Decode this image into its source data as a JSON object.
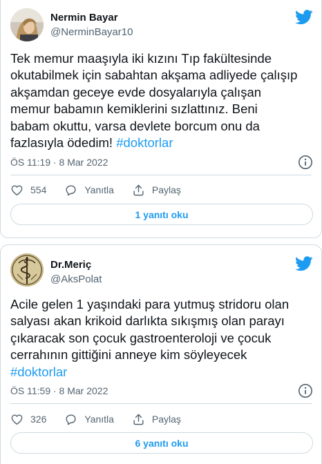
{
  "tweets": [
    {
      "author_name": "Nermin Bayar",
      "author_handle": "@NerminBayar10",
      "text": "Tek memur maaşıyla iki kızını Tıp fakültesinde\nokutabilmek için sabahtan akşama adliyede çalışıp\nakşamdan geceye evde dosyalarıyla çalışan\nmemur babamın kemiklerini sızlattınız. Beni\nbabam okuttu, varsa devlete borcum onu da\nfazlasıyla ödedim! ",
      "hashtag": "#doktorlar",
      "timestamp": "ÖS 11:19 · 8 Mar 2022",
      "like_count": "554",
      "reply_label": "Yanıtla",
      "share_label": "Paylaş",
      "replies_button": "1 yanıtı oku"
    },
    {
      "author_name": "Dr.Meriç",
      "author_handle": "@AksPolat",
      "text": "Acile gelen 1 yaşındaki para yutmuş stridoru olan\nsalyası akan krikoid darlıkta sıkışmış olan parayı\nçıkaracak son çocuk gastroenteroloji ve çocuk\ncerrahının gittiğini anneye kim söyleyecek\n",
      "hashtag": "#doktorlar",
      "timestamp": "ÖS 11:59 · 8 Mar 2022",
      "like_count": "326",
      "reply_label": "Yanıtla",
      "share_label": "Paylaş",
      "replies_button": "6 yanıtı oku"
    }
  ],
  "icons": {
    "brand": "twitter-bird-icon",
    "like": "heart-icon",
    "reply": "speech-bubble-icon",
    "share": "share-upload-icon",
    "info": "info-icon"
  },
  "colors": {
    "accent": "#1d9bf0",
    "text": "#0f1419",
    "muted": "#536471",
    "border": "#cfd9de"
  }
}
